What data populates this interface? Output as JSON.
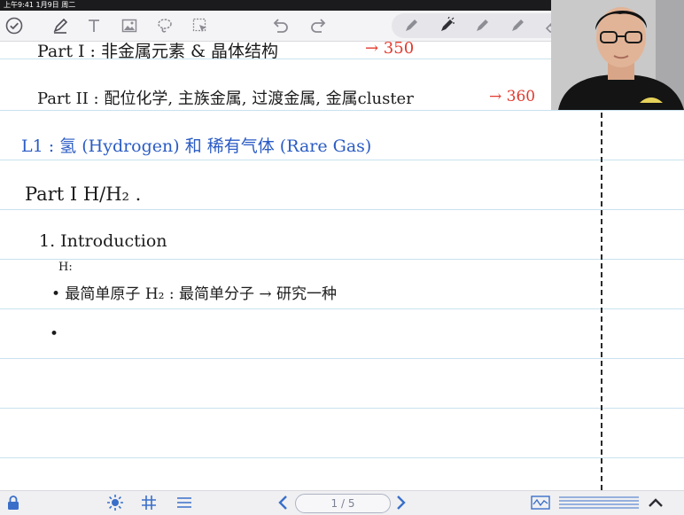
{
  "status_bar": {
    "time_date": "上午9:41   1月9日 周二"
  },
  "toolbar": {
    "icons": [
      "checkmark-circle-icon",
      "pen-icon",
      "text-icon",
      "image-icon",
      "lasso-icon",
      "pointer-icon",
      "undo-icon",
      "redo-icon",
      "redo-arrow-icon"
    ],
    "pen_presets": [
      "pen-icon",
      "pen-icon",
      "pen-icon",
      "pen-icon",
      "eraser-icon"
    ]
  },
  "notes": {
    "part1_line": "Part I : 非金属元素 & 晶体结构",
    "part1_page": "→ 350",
    "part2_line": "Part II : 配位化学, 主族金属, 过渡金属, 金属cluster",
    "part2_page": "→ 360",
    "lesson_title": "L1 : 氢 (Hydrogen) 和 稀有气体 (Rare Gas)",
    "section": "Part I  H/H₂ .",
    "subsection": "1. Introduction",
    "annotation": "H:",
    "bullet1": "• 最简单原子    H₂ : 最简单分子 → 研究一种",
    "bullet2": "•"
  },
  "bottom_bar": {
    "page_indicator": "1 / 5"
  },
  "colors": {
    "ink_black": "#1c1c1c",
    "ink_blue": "#2a5bc4",
    "ink_red": "#e23a2e",
    "rule_line": "#c9e2ef",
    "accent": "#3a6fc9"
  }
}
